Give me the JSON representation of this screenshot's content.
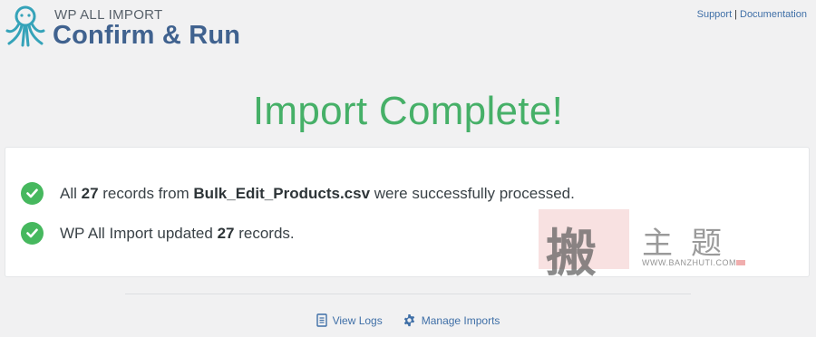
{
  "header": {
    "brand_small": "WP ALL IMPORT",
    "title": "Confirm & Run",
    "links": {
      "support": "Support",
      "separator": "|",
      "documentation": "Documentation"
    }
  },
  "main": {
    "heading": "Import Complete!",
    "result_line_1": {
      "prefix": "All ",
      "count": "27",
      "middle": " records from ",
      "filename": "Bulk_Edit_Products.csv",
      "suffix": " were successfully processed."
    },
    "result_line_2": {
      "prefix": "WP All Import updated ",
      "count": "27",
      "suffix": " records."
    }
  },
  "watermark": {
    "seal_char": "搬",
    "chars": "主题",
    "url": "WWW.BANZHUTI.COM"
  },
  "footer": {
    "view_logs": "View Logs",
    "manage_imports": "Manage Imports"
  },
  "colors": {
    "accent_green": "#46b068",
    "check_green": "#46b85e",
    "brand_blue": "#40628f",
    "link_blue": "#3f6fa7"
  },
  "icons": {
    "logo": "octopus-logo-icon",
    "check": "check-circle-icon",
    "logs": "document-icon",
    "manage": "gear-icon"
  }
}
